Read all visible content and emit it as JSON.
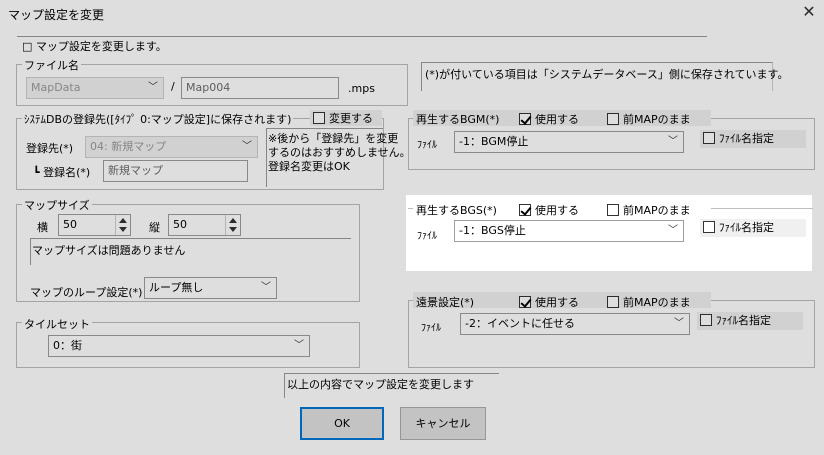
{
  "window": {
    "title": "マップ設定を変更",
    "close_glyph": "✕"
  },
  "intro_text": "□ マップ設定を変更します。",
  "filename": {
    "label": "ファイル名",
    "folder": "MapData",
    "separator": "/",
    "name": "Map004",
    "extension": ".mps"
  },
  "note_asterisk": "(*)が付いている項目は「システムデータベース」側に保存されています。",
  "sysdb": {
    "header": "ｼｽﾃﾑDBの登録先([ﾀｲﾌﾟ 0:マップ設定]に保存されます)",
    "change_label": "変更する",
    "dest_label": "登録先(*)",
    "dest_value": "04: 新規マップ",
    "regname_label": "┗ 登録名(*)",
    "regname_value": "新規マップ",
    "note_lines": [
      "※後から「登録先」を変更",
      "するのはおすすめしません。",
      "登録名変更はOK"
    ]
  },
  "mapsize": {
    "header": "マップサイズ",
    "width_label": "横",
    "width_value": "50",
    "height_label": "縦",
    "height_value": "50",
    "status": "マップサイズは問題ありません",
    "loop_label": "マップのループ設定(*)",
    "loop_value": "ループ無し"
  },
  "tileset": {
    "header": "タイルセット",
    "value": "0：街"
  },
  "bgm": {
    "header": "再生するBGM(*)",
    "use_label": "使用する",
    "keep_label": "前MAPのまま",
    "file_label": "ﾌｧｲﾙ",
    "file_value": "-1：BGM停止",
    "specify_label": "ﾌｧｲﾙ名指定"
  },
  "bgs": {
    "header": "再生するBGS(*)",
    "use_label": "使用する",
    "keep_label": "前MAPのまま",
    "file_label": "ﾌｧｲﾙ",
    "file_value": "-1：BGS停止",
    "specify_label": "ﾌｧｲﾙ名指定"
  },
  "distant": {
    "header": "遠景設定(*)",
    "use_label": "使用する",
    "keep_label": "前MAPのまま",
    "file_label": "ﾌｧｲﾙ",
    "file_value": "-2：イベントに任せる",
    "specify_label": "ﾌｧｲﾙ名指定"
  },
  "footer": {
    "confirm_text": "以上の内容でマップ設定を変更します",
    "ok_label": "OK",
    "cancel_label": "キャンセル"
  }
}
